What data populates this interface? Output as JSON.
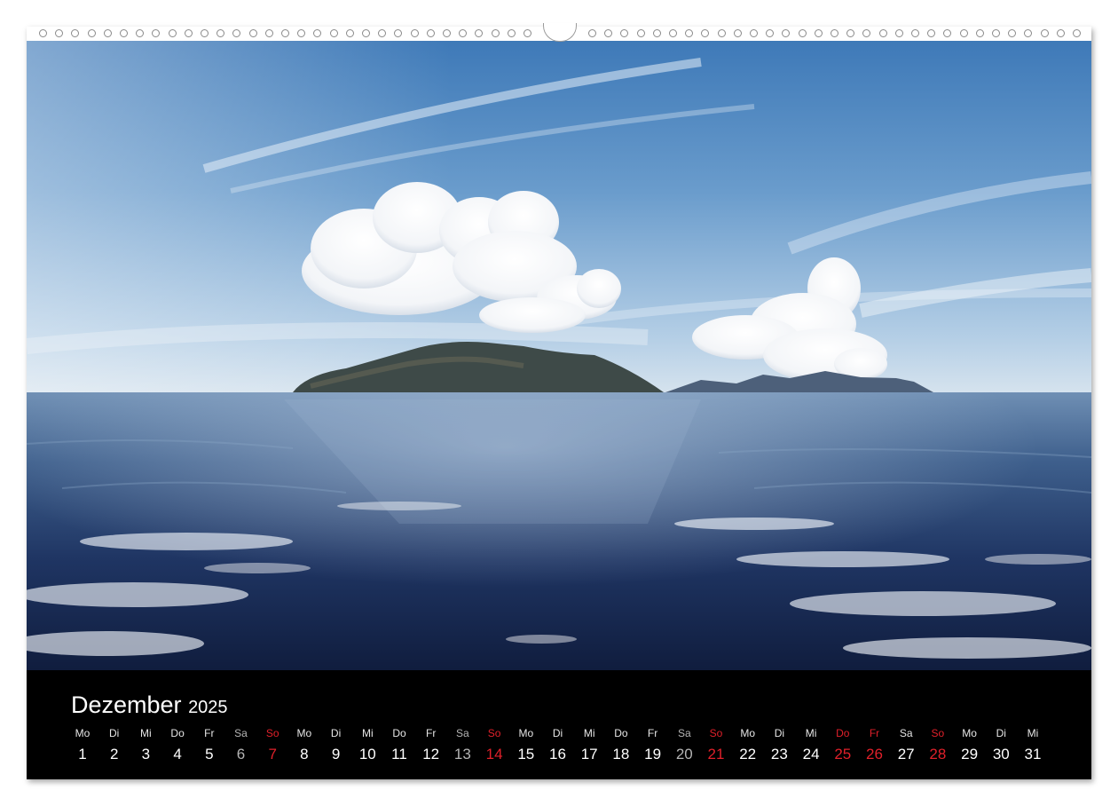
{
  "calendar": {
    "month": "Dezember",
    "year": "2025",
    "weekdays": [
      "Mo",
      "Di",
      "Mi",
      "Do",
      "Fr",
      "Sa",
      "So",
      "Mo",
      "Di",
      "Mi",
      "Do",
      "Fr",
      "Sa",
      "So",
      "Mo",
      "Di",
      "Mi",
      "Do",
      "Fr",
      "Sa",
      "So",
      "Mo",
      "Di",
      "Mi",
      "Do",
      "Fr",
      "Sa",
      "So",
      "Mo",
      "Di",
      "Mi"
    ],
    "days": [
      "1",
      "2",
      "3",
      "4",
      "5",
      "6",
      "7",
      "8",
      "9",
      "10",
      "11",
      "12",
      "13",
      "14",
      "15",
      "16",
      "17",
      "18",
      "19",
      "20",
      "21",
      "22",
      "23",
      "24",
      "25",
      "26",
      "27",
      "28",
      "29",
      "30",
      "31"
    ],
    "highlight": [
      "",
      "",
      "",
      "",
      "",
      "sat",
      "red",
      "",
      "",
      "",
      "",
      "",
      "sat",
      "red",
      "",
      "",
      "",
      "",
      "",
      "sat",
      "red",
      "",
      "",
      "",
      "red",
      "red",
      "",
      "red",
      "",
      "",
      ""
    ]
  },
  "photo": {
    "subject": "island-at-sea",
    "colors": {
      "sky_top": "#2f6fb4",
      "sky_horizon": "#c9ddec",
      "sea_dark": "#14244a",
      "sea_light": "#5d7fa6"
    }
  }
}
